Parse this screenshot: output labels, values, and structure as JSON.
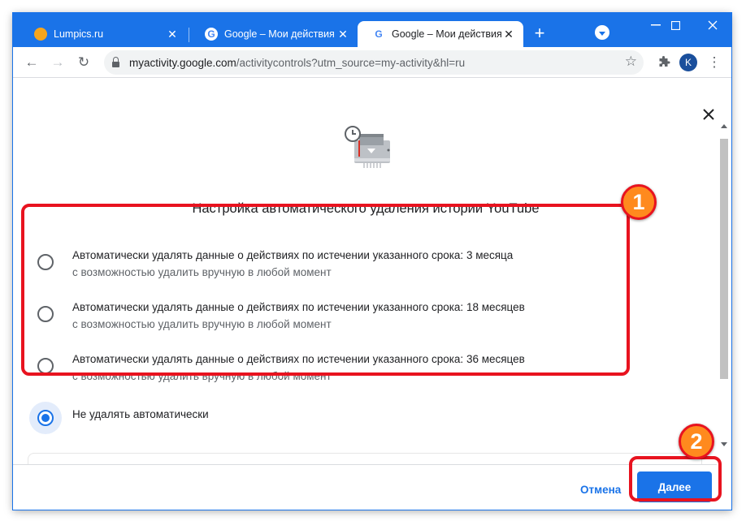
{
  "browser": {
    "tabs": [
      {
        "title": "Lumpics.ru",
        "favicon": "lumpics-icon",
        "active": false
      },
      {
        "title": "Google – Мои действия",
        "favicon": "google-icon",
        "active": false
      },
      {
        "title": "Google – Мои действия",
        "favicon": "google-icon",
        "active": true
      }
    ],
    "new_tab_glyph": "+",
    "window_controls": {
      "minimize": "—",
      "maximize": "☐",
      "close": "✕"
    },
    "toolbar": {
      "back": "←",
      "forward": "→",
      "reload": "↻",
      "url_host": "myactivity.google.com",
      "url_path": "/activitycontrols?utm_source=my-activity&hl=ru",
      "star": "☆",
      "extensions": "puzzle-icon",
      "profile_initial": "K",
      "menu": "⋮"
    },
    "accent": "#1a73e8"
  },
  "dialog": {
    "close_glyph": "✕",
    "heading": "Настройка автоматического удаления истории YouTube",
    "options": [
      {
        "label": "Автоматически удалять данные о действиях по истечении указанного срока: 3 месяца",
        "sub": "с возможностью удалить вручную в любой момент",
        "selected": false
      },
      {
        "label": "Автоматически удалять данные о действиях по истечении указанного срока: 18 месяцев",
        "sub": "с возможностью удалить вручную в любой момент",
        "selected": false
      },
      {
        "label": "Автоматически удалять данные о действиях по истечении указанного срока: 36 месяцев",
        "sub": "с возможностью удалить вручную в любой момент",
        "selected": false
      }
    ],
    "no_delete": {
      "label": "Не удалять автоматически",
      "selected": true
    },
    "cancel_label": "Отмена",
    "next_label": "Далее"
  },
  "annotations": {
    "badge1": "1",
    "badge2": "2",
    "highlight_color": "#e8131f",
    "badge_color": "#ff8a1e"
  }
}
